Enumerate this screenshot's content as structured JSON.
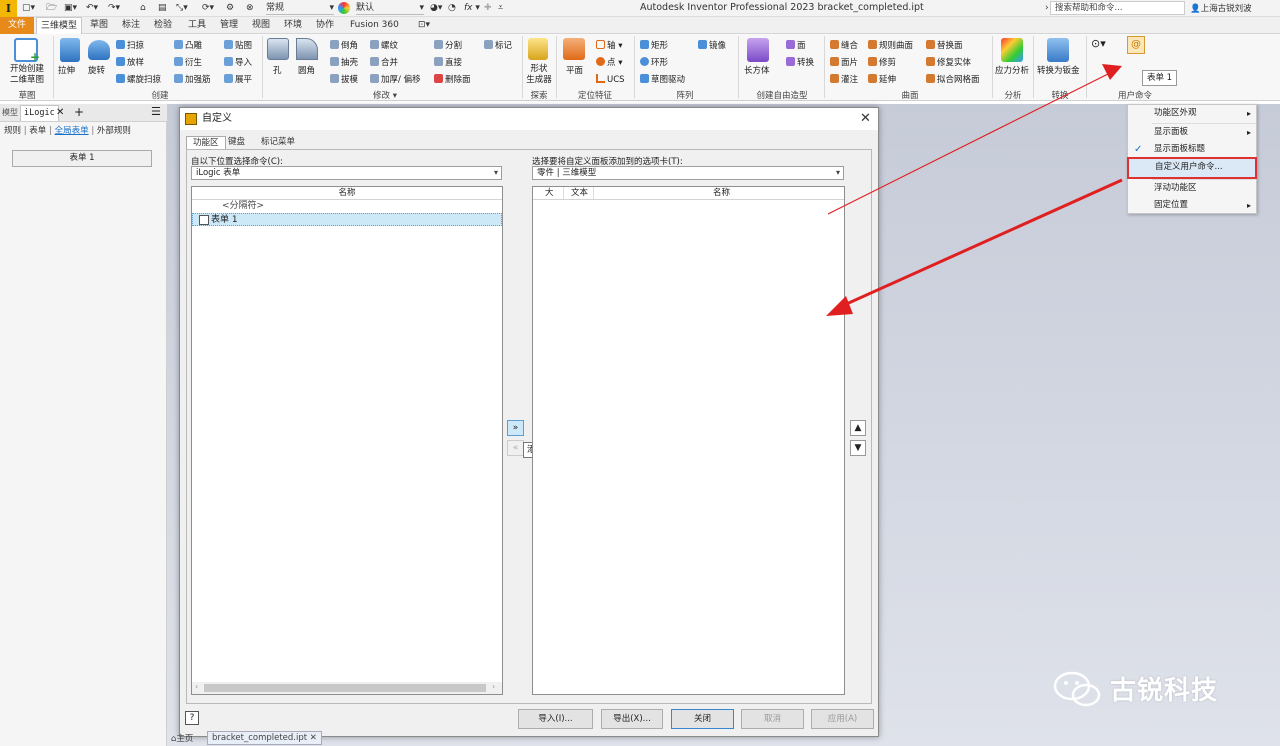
{
  "titlebar": {
    "app_logo": "I",
    "title": "Autodesk Inventor Professional 2023    bracket_completed.ipt",
    "help_search": "搜索帮助和命令...",
    "user": "上海古锐刘波",
    "appearance": "常规",
    "material": "默认"
  },
  "tabs": [
    "文件",
    "三维模型",
    "草图",
    "标注",
    "检验",
    "工具",
    "管理",
    "视图",
    "环境",
    "协作",
    "Fusion 360"
  ],
  "ribbon": {
    "start_sketch": "开始创建\n二维草图",
    "group_sketch": "草图",
    "extrude": "拉伸",
    "revolve": "旋转",
    "sweep": "扫掠",
    "loft": "放样",
    "coil_sweep": "螺旋扫掠",
    "emboss": "凸雕",
    "derive": "衍生",
    "rib": "加强筋",
    "decal": "贴图",
    "import": "导入",
    "unfold": "展平",
    "group_create": "创建",
    "hole": "孔",
    "fillet": "圆角",
    "chamfer": "倒角",
    "shell": "抽壳",
    "draft": "拔模",
    "thread": "螺纹",
    "combine": "合并",
    "thicken": "加厚/ 偏移",
    "split": "分割",
    "direct": "直接",
    "delete_face": "删除面",
    "mark": "标记",
    "group_modify": "修改 ▾",
    "shape_gen": "形状\n生成器",
    "group_explore": "探索",
    "plane": "平面",
    "axis": "轴 ▾",
    "point": "点 ▾",
    "ucs": "UCS",
    "group_workfeat": "定位特征",
    "rect": "矩形",
    "circ": "环形",
    "sketch_driven": "草图驱动",
    "mirror": "镜像",
    "group_pattern": "阵列",
    "box": "长方体",
    "face": "面",
    "convert": "转换",
    "group_freeform": "创建自由造型",
    "stitch": "缝合",
    "patch": "面片",
    "sculpt": "灌注",
    "ruled": "规则曲面",
    "trim": "修剪",
    "extend": "延伸",
    "replace_face": "替换面",
    "repair": "修复实体",
    "fit_mesh": "拟合网格面",
    "group_surface": "曲面",
    "stress": "应力分析",
    "group_analysis": "分析",
    "convert_sm": "转换为钣金",
    "group_convert": "转换",
    "group_user": "用户命令",
    "tooltip": "表单 1"
  },
  "leftpanel": {
    "tab_model": "模型",
    "tab_ilogic": "iLogic",
    "rules": "规则",
    "forms": "表单",
    "global_forms": "全局表单",
    "external_rules": "外部规则",
    "form1": "表单 1"
  },
  "dialog": {
    "title": "自定义",
    "tabs": [
      "功能区",
      "键盘",
      "标记菜单"
    ],
    "left_label": "自以下位置选择命令(C):",
    "left_combo": "iLogic 表单",
    "left_header": "名称",
    "left_items": [
      "<分隔符>",
      "表单 1"
    ],
    "right_label": "选择要将自定义面板添加到的选项卡(T):",
    "right_combo": "零件 | 三维模型",
    "right_headers": [
      "大",
      "文本",
      "名称"
    ],
    "add_btn": "»",
    "remove_btn": "«",
    "add_tooltip": "添加",
    "up": "▲",
    "down": "▼",
    "import_btn": "导入(I)...",
    "export_btn": "导出(X)...",
    "close_btn": "关闭",
    "cancel_btn": "取消",
    "apply_btn": "应用(A)"
  },
  "context_menu": {
    "items": [
      "功能区外观",
      "显示面板",
      "显示面板标题",
      "自定义用户命令...",
      "浮动功能区",
      "固定位置"
    ]
  },
  "doctabs": {
    "home": "主页",
    "doc": "bracket_completed.ipt"
  },
  "watermark": "古锐科技",
  "colors": {
    "file_tab": "#e88a1a",
    "highlight_box": "#e03030",
    "arrow": "#e02020",
    "selection": "#cde8f7"
  }
}
